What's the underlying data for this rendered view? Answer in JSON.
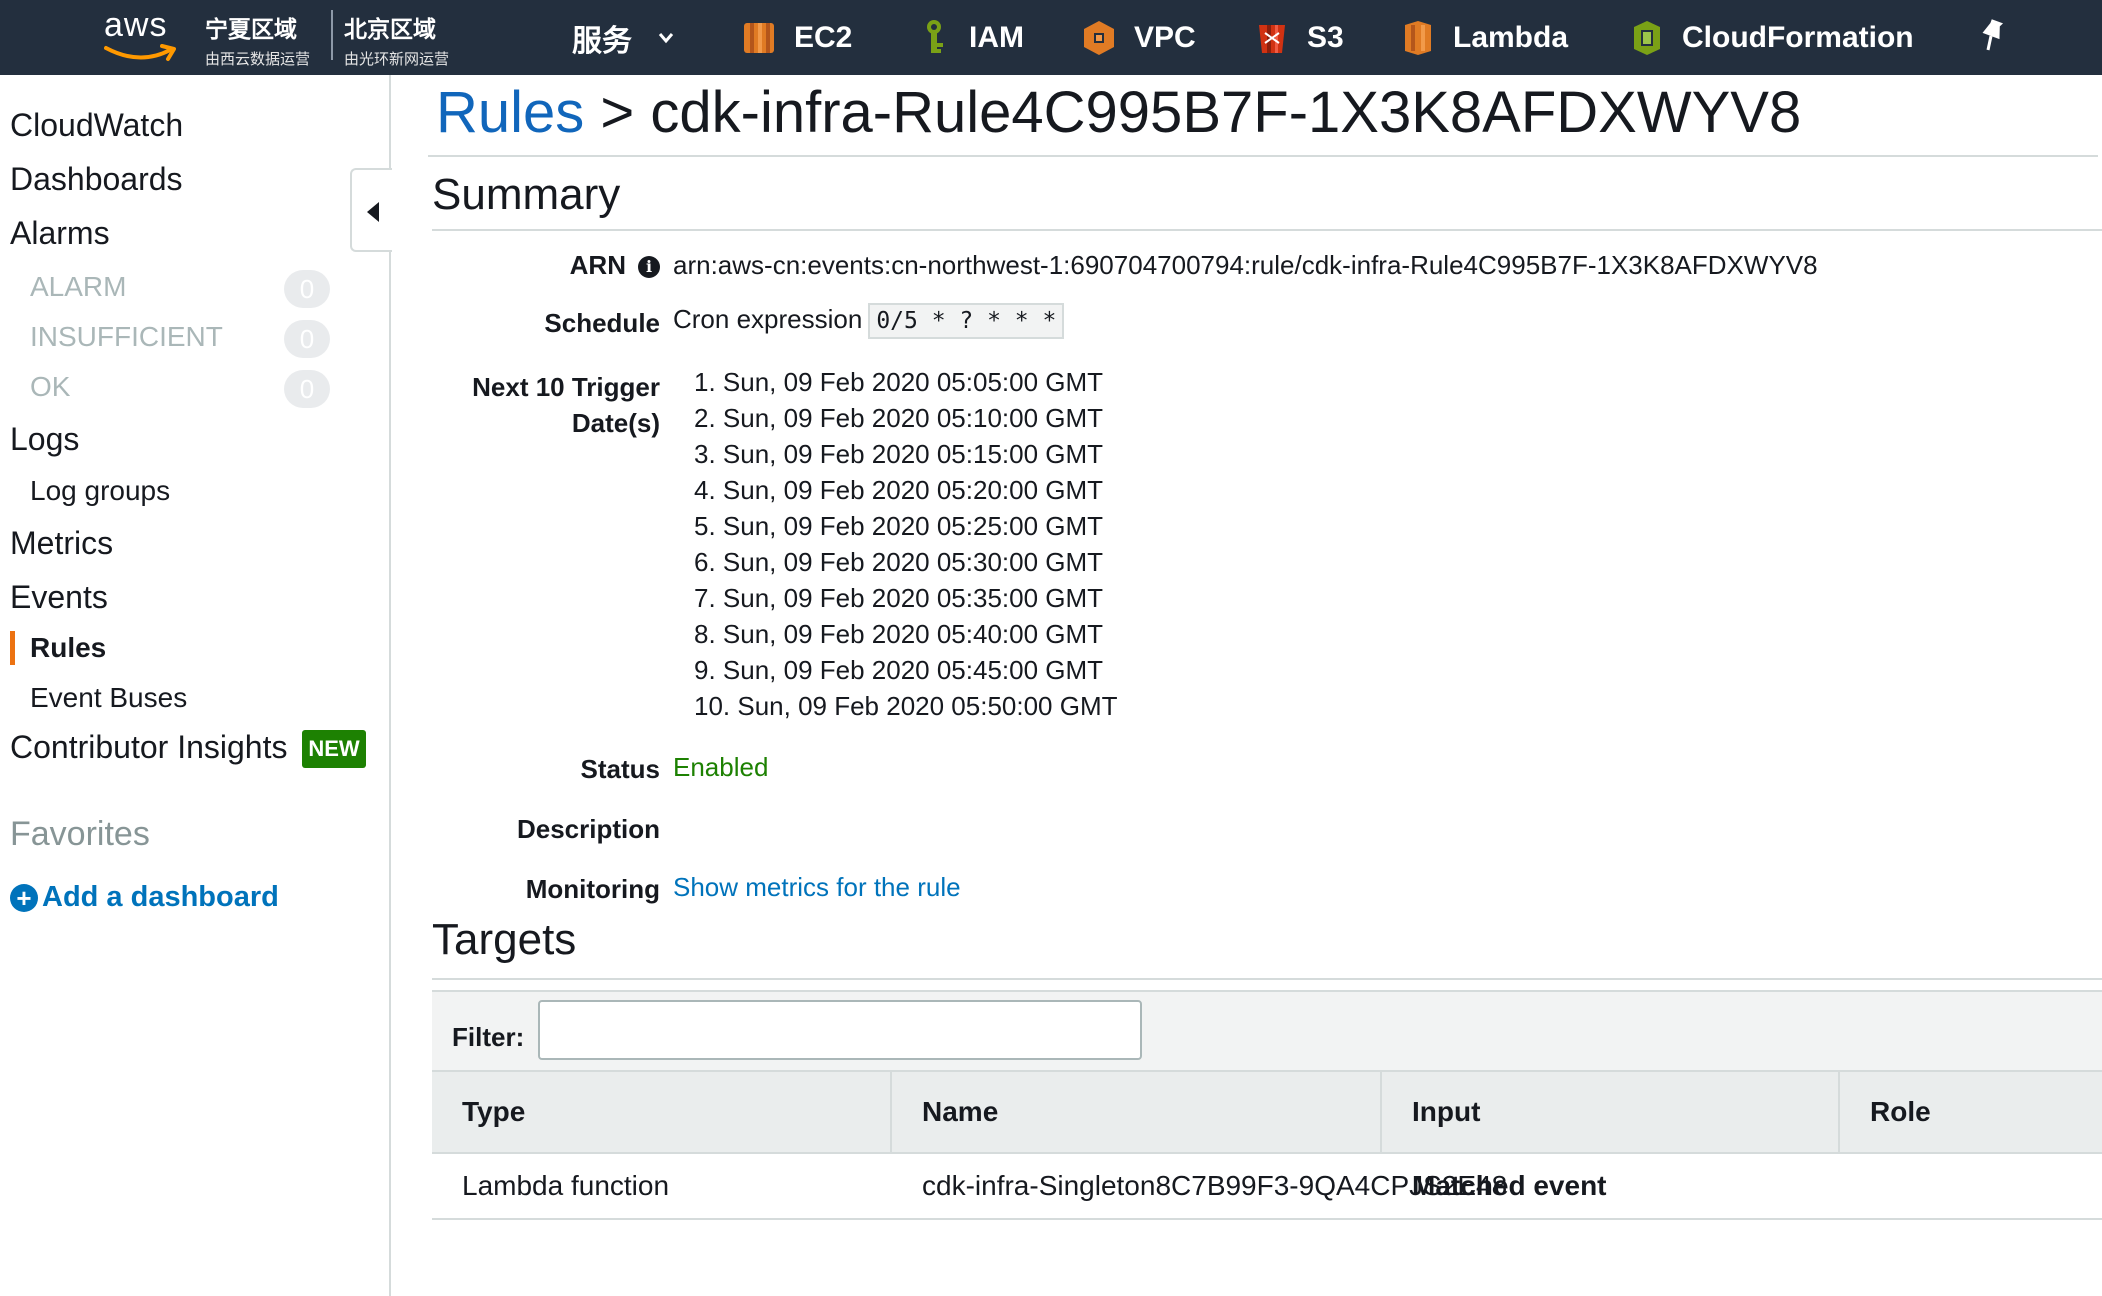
{
  "topbar": {
    "logo_text": "aws",
    "region1": {
      "main": "宁夏区域",
      "sub": "由西云数据运营"
    },
    "region2": {
      "main": "北京区域",
      "sub": "由光环新网运营"
    },
    "services_label": "服务",
    "nav": [
      {
        "label": "EC2",
        "icon": "ec2-icon",
        "color": "#e07b24"
      },
      {
        "label": "IAM",
        "icon": "iam-icon",
        "color": "#7aa116"
      },
      {
        "label": "VPC",
        "icon": "vpc-icon",
        "color": "#e07b24"
      },
      {
        "label": "S3",
        "icon": "s3-icon",
        "color": "#d13212"
      },
      {
        "label": "Lambda",
        "icon": "lambda-icon",
        "color": "#e07b24"
      },
      {
        "label": "CloudFormation",
        "icon": "cloudformation-icon",
        "color": "#7aa116"
      }
    ],
    "pin_icon": "pin-icon"
  },
  "sidebar": {
    "cloudwatch": "CloudWatch",
    "dashboards": "Dashboards",
    "alarms": "Alarms",
    "alarm_states": [
      {
        "label": "ALARM",
        "count": "0"
      },
      {
        "label": "INSUFFICIENT",
        "count": "0"
      },
      {
        "label": "OK",
        "count": "0"
      }
    ],
    "logs": "Logs",
    "log_groups": "Log groups",
    "metrics": "Metrics",
    "events": "Events",
    "rules": "Rules",
    "event_buses": "Event Buses",
    "contributor_insights": "Contributor Insights",
    "new_badge": "NEW",
    "favorites": "Favorites",
    "add_dashboard": "Add a dashboard",
    "accent_color": "#ec7211"
  },
  "main": {
    "breadcrumb_link": "Rules",
    "breadcrumb_sep": " > ",
    "rule_name": "cdk-infra-Rule4C995B7F-1X3K8AFDXWYV8",
    "summary_heading": "Summary",
    "arn_label": "ARN",
    "arn_value": "arn:aws-cn:events:cn-northwest-1:690704700794:rule/cdk-infra-Rule4C995B7F-1X3K8AFDXWYV8",
    "schedule_label": "Schedule",
    "schedule_prefix": "Cron expression",
    "cron_expression": "0/5 * ? * * *",
    "next_trigger_label_line1": "Next 10 Trigger",
    "next_trigger_label_line2": "Date(s)",
    "trigger_dates": [
      "1. Sun, 09 Feb 2020 05:05:00 GMT",
      "2. Sun, 09 Feb 2020 05:10:00 GMT",
      "3. Sun, 09 Feb 2020 05:15:00 GMT",
      "4. Sun, 09 Feb 2020 05:20:00 GMT",
      "5. Sun, 09 Feb 2020 05:25:00 GMT",
      "6. Sun, 09 Feb 2020 05:30:00 GMT",
      "7. Sun, 09 Feb 2020 05:35:00 GMT",
      "8. Sun, 09 Feb 2020 05:40:00 GMT",
      "9. Sun, 09 Feb 2020 05:45:00 GMT",
      "10. Sun, 09 Feb 2020 05:50:00 GMT"
    ],
    "status_label": "Status",
    "status_value": "Enabled",
    "description_label": "Description",
    "description_value": "",
    "monitoring_label": "Monitoring",
    "monitoring_link": "Show metrics for the rule",
    "targets_heading": "Targets",
    "filter_label": "Filter:",
    "filter_value": "",
    "table": {
      "columns": [
        "Type",
        "Name",
        "Input",
        "Role"
      ],
      "rows": [
        {
          "type": "Lambda function",
          "name": "cdk-infra-Singleton8C7B99F3-9QA4CPJS2E48",
          "input": "Matched event",
          "role": ""
        }
      ]
    },
    "link_color": "#0073bb",
    "status_color": "#1d8102"
  }
}
